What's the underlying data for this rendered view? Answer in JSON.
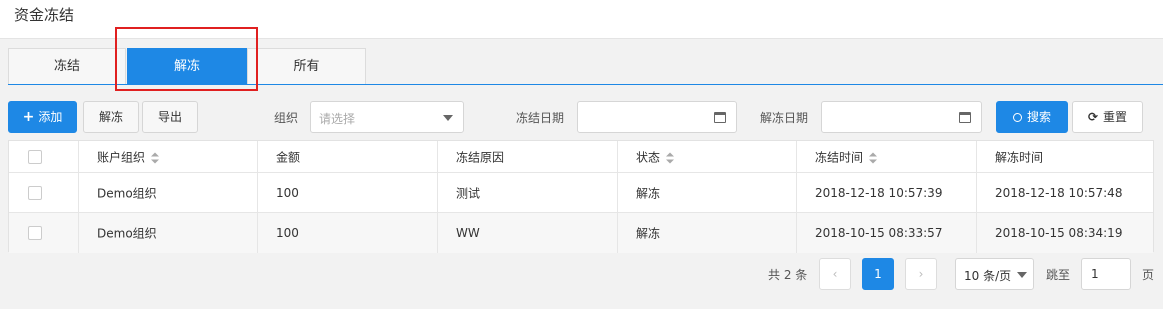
{
  "page": {
    "title": "资金冻结"
  },
  "tabs": [
    {
      "label": "冻结"
    },
    {
      "label": "解冻"
    },
    {
      "label": "所有"
    }
  ],
  "toolbar": {
    "add_label": "添加",
    "unfreeze_label": "解冻",
    "export_label": "导出",
    "org_label": "组织",
    "org_placeholder": "请选择",
    "freeze_date_label": "冻结日期",
    "unfreeze_date_label": "解冻日期",
    "search_label": "搜索",
    "reset_label": "重置"
  },
  "table": {
    "columns": [
      "账户组织",
      "金额",
      "冻结原因",
      "状态",
      "冻结时间",
      "解冻时间"
    ],
    "rows": [
      [
        "Demo组织",
        "100",
        "测试",
        "解冻",
        "2018-12-18 10:57:39",
        "2018-12-18 10:57:48"
      ],
      [
        "Demo组织",
        "100",
        "WW",
        "解冻",
        "2018-10-15 08:33:57",
        "2018-10-15 08:34:19"
      ]
    ]
  },
  "pagination": {
    "total_text": "共 2 条",
    "prev_symbol": "‹",
    "current_page": "1",
    "next_symbol": "›",
    "page_size": "10 条/页",
    "goto_label": "跳至",
    "goto_value": "1",
    "page_suffix": "页"
  },
  "colors": {
    "primary": "#1e88e5",
    "highlight": "#e02020"
  }
}
